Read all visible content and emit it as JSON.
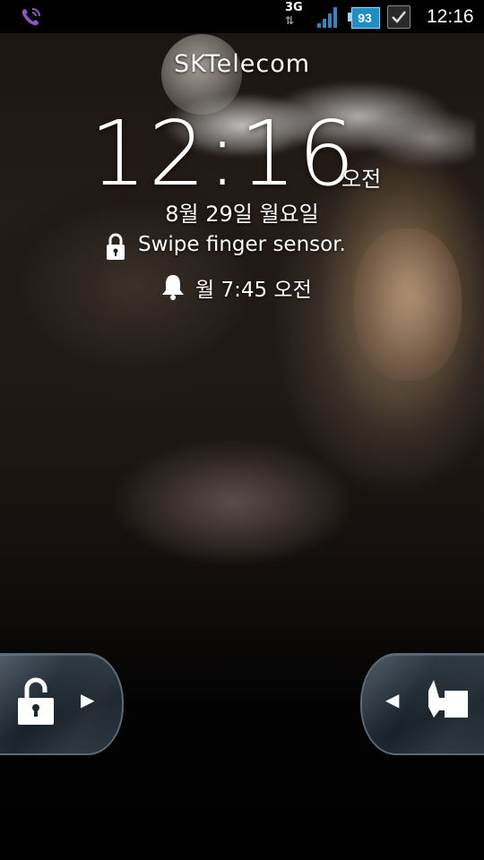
{
  "status_bar": {
    "network_type": "3G",
    "network_arrows": "⇅",
    "battery_level": "93",
    "time": "12:16",
    "icons": [
      "viber-call-icon",
      "signal-icon",
      "battery-icon",
      "task-check-icon"
    ],
    "battery_color": "#1e8fc4"
  },
  "lockscreen": {
    "carrier": "SKTelecom",
    "clock_time": "12:16",
    "clock_ampm": "오전",
    "date": "8월 29일 월요일",
    "hint": "Swipe finger sensor.",
    "alarm": "월 7:45 오전"
  },
  "unlock_tabs": {
    "left_icon": "unlock-icon",
    "left_arrow": "▶",
    "right_arrow": "◀",
    "right_icon": "sound-icon"
  }
}
